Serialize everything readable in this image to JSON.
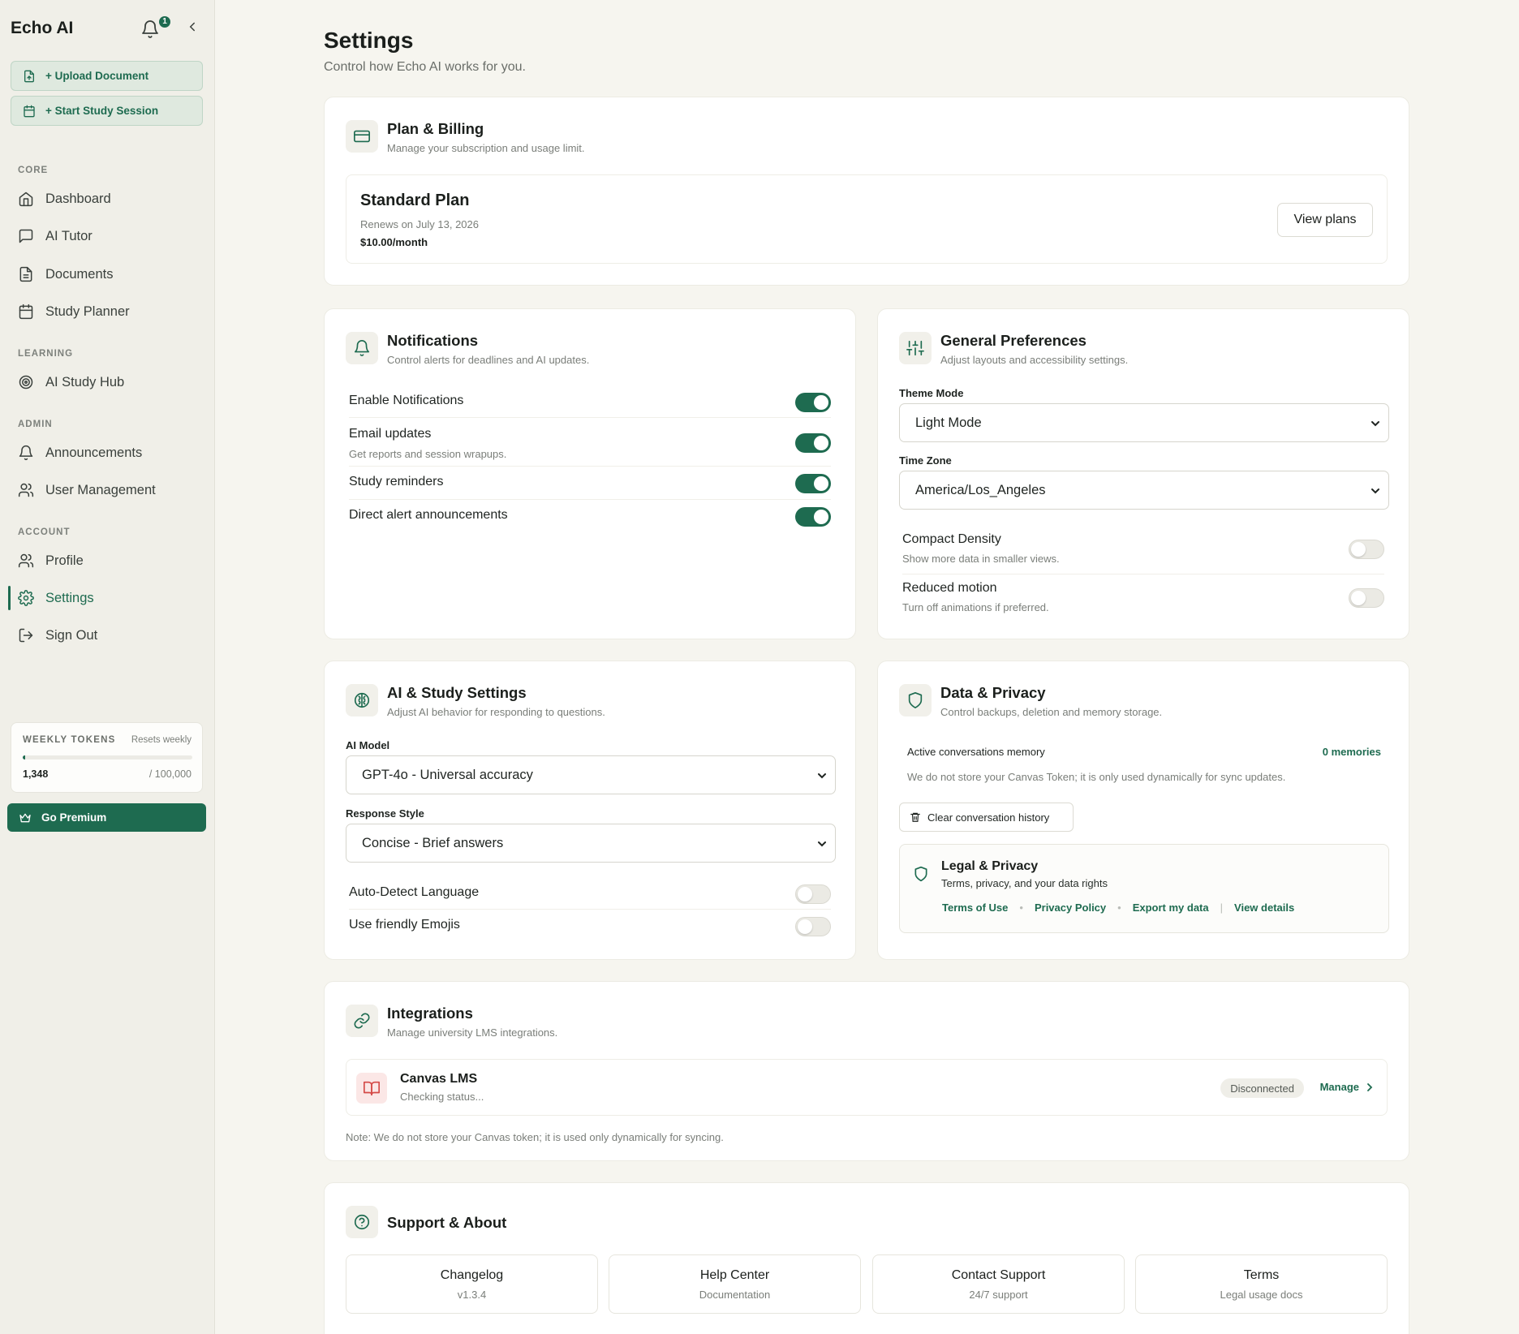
{
  "app": {
    "title": "Echo AI",
    "notification_count": "1"
  },
  "sidebar": {
    "actions": {
      "upload": "+ Upload Document",
      "study": "+ Start Study Session"
    },
    "sections": {
      "core": "CORE",
      "learning": "LEARNING",
      "admin": "ADMIN",
      "account": "ACCOUNT"
    },
    "items": {
      "dashboard": "Dashboard",
      "ai_tutor": "AI Tutor",
      "documents": "Documents",
      "study_planner": "Study Planner",
      "ai_study_hub": "AI Study Hub",
      "announcements": "Announcements",
      "user_management": "User Management",
      "profile": "Profile",
      "settings": "Settings",
      "sign_out": "Sign Out"
    },
    "tokens": {
      "title": "WEEKLY TOKENS",
      "reset": "Resets weekly",
      "used": "1,348",
      "limit": "/ 100,000",
      "fraction": 0.01348
    },
    "premium_label": "Go Premium"
  },
  "page": {
    "title": "Settings",
    "subtitle": "Control how Echo AI works for you."
  },
  "billing": {
    "title": "Plan & Billing",
    "desc": "Manage your subscription and usage limit.",
    "plan_name": "Standard Plan",
    "renews": "Renews on July 13, 2026",
    "price": "$10.00/month",
    "view_plans": "View plans"
  },
  "notifications": {
    "title": "Notifications",
    "desc": "Control alerts for deadlines and AI updates.",
    "enable": "Enable Notifications",
    "email": "Email updates",
    "email_desc": "Get reports and session wrapups.",
    "reminders": "Study reminders",
    "direct": "Direct alert announcements"
  },
  "preferences": {
    "title": "General Preferences",
    "desc": "Adjust layouts and accessibility settings.",
    "theme_label": "Theme Mode",
    "theme_value": "Light Mode",
    "tz_label": "Time Zone",
    "tz_value": "America/Los_Angeles",
    "compact": "Compact Density",
    "compact_desc": "Show more data in smaller views.",
    "motion": "Reduced motion",
    "motion_desc": "Turn off animations if preferred."
  },
  "ai_settings": {
    "title": "AI & Study Settings",
    "desc": "Adjust AI behavior for responding to questions.",
    "model_label": "AI Model",
    "model_value": "GPT-4o - Universal accuracy",
    "style_label": "Response Style",
    "style_value": "Concise - Brief answers",
    "auto_detect": "Auto-Detect Language",
    "emojis": "Use friendly Emojis"
  },
  "privacy": {
    "title": "Data & Privacy",
    "desc": "Control backups, deletion and memory storage.",
    "memory_label": "Active conversations memory",
    "memory_count": "0 memories",
    "memory_note": "We do not store your Canvas Token; it is only used dynamically for sync updates.",
    "clear_btn": "Clear conversation history",
    "legal_title": "Legal & Privacy",
    "legal_sub": "Terms, privacy, and your data rights",
    "links": {
      "terms": "Terms of Use",
      "privacy": "Privacy Policy",
      "export": "Export my data",
      "details": "View details"
    }
  },
  "integrations": {
    "title": "Integrations",
    "desc": "Manage university LMS integrations.",
    "canvas_name": "Canvas LMS",
    "canvas_status": "Checking status...",
    "badge": "Disconnected",
    "manage": "Manage",
    "note": "Note: We do not store your Canvas token; it is used only dynamically for syncing."
  },
  "support": {
    "title": "Support & About",
    "tiles": [
      {
        "title": "Changelog",
        "sub": "v1.3.4"
      },
      {
        "title": "Help Center",
        "sub": "Documentation"
      },
      {
        "title": "Contact Support",
        "sub": "24/7 support"
      },
      {
        "title": "Terms",
        "sub": "Legal usage docs"
      }
    ]
  },
  "colors": {
    "accent": "#1e6b50",
    "background": "#f6f5ef",
    "danger_bg": "#fbe7e6"
  }
}
